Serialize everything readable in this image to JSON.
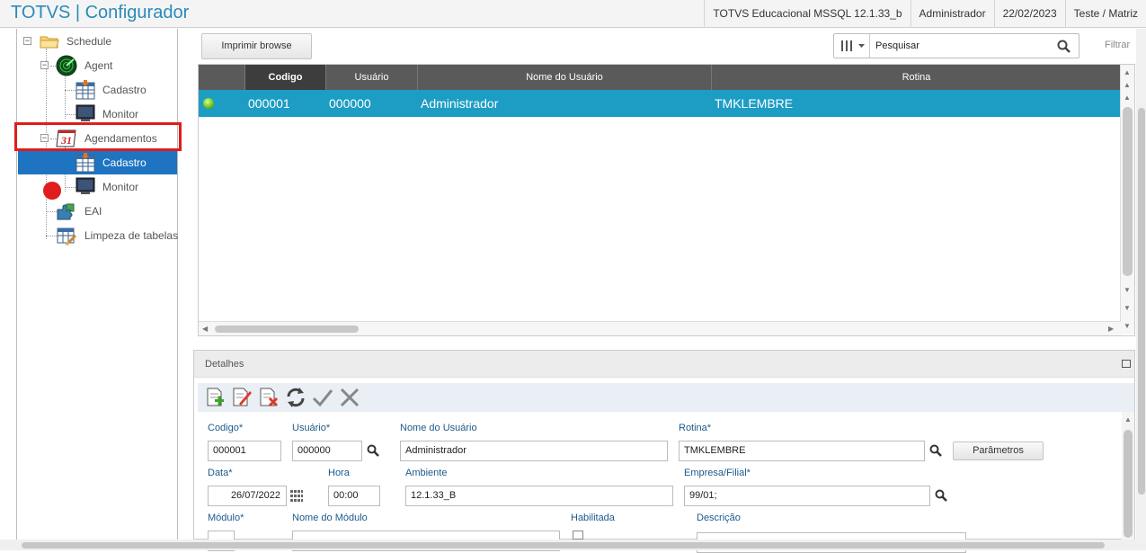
{
  "header": {
    "title": "TOTVS | Configurador",
    "environment": "TOTVS Educacional MSSQL 12.1.33_b",
    "user": "Administrador",
    "date": "22/02/2023",
    "company": "Teste / Matriz"
  },
  "sidebar": {
    "items": [
      {
        "label": "Schedule",
        "icon": "folder-icon"
      },
      {
        "label": "Agent",
        "icon": "radar-icon"
      },
      {
        "label": "Cadastro",
        "icon": "table-icon"
      },
      {
        "label": "Monitor",
        "icon": "monitor-icon"
      },
      {
        "label": "Agendamentos",
        "icon": "calendar-icon"
      },
      {
        "label": "Cadastro",
        "icon": "table-icon",
        "selected": true
      },
      {
        "label": "Monitor",
        "icon": "monitor-icon"
      },
      {
        "label": "EAI",
        "icon": "puzzle-icon"
      },
      {
        "label": "Limpeza de tabelas",
        "icon": "clean-table-icon"
      }
    ]
  },
  "toolbar": {
    "print_label": "Imprimir browse",
    "search_placeholder": "Pesquisar",
    "filter_label": "Filtrar"
  },
  "grid": {
    "columns": [
      "Codigo",
      "Usuário",
      "Nome do Usuário",
      "Rotina"
    ],
    "rows": [
      {
        "status": "green",
        "codigo": "000001",
        "usuario": "000000",
        "nome": "Administrador",
        "rotina": "TMKLEMBRE"
      }
    ]
  },
  "details": {
    "title": "Detalhes",
    "fields": {
      "codigo_label": "Codigo*",
      "codigo_value": "000001",
      "usuario_label": "Usuário*",
      "usuario_value": "000000",
      "nome_label": "Nome do Usuário",
      "nome_value": "Administrador",
      "rotina_label": "Rotina*",
      "rotina_value": "TMKLEMBRE",
      "parametros_label": "Parâmetros",
      "data_label": "Data*",
      "data_value": "26/07/2022",
      "hora_label": "Hora",
      "hora_value": "00:00",
      "ambiente_label": "Ambiente",
      "ambiente_value": "12.1.33_B",
      "empresa_label": "Empresa/Filial*",
      "empresa_value": "99/01;",
      "modulo_label": "Módulo*",
      "modulo_value": "",
      "nome_modulo_label": "Nome do Módulo",
      "nome_modulo_value": "",
      "habilitada_label": "Habilitada",
      "descricao_label": "Descrição"
    }
  },
  "colors": {
    "title": "#2a8bb8",
    "selected_row": "#1d9dc4",
    "tree_selected": "#1e74c0",
    "highlight": "#e01c1c"
  }
}
